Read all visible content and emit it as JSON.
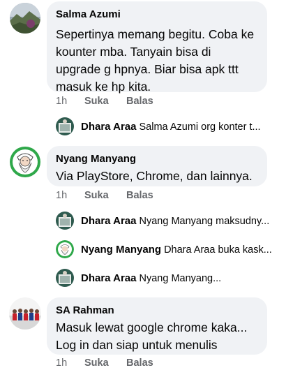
{
  "comments": [
    {
      "author": "Salma Azumi",
      "lines": [
        "Sepertinya memang begitu. Coba ke",
        "kounter mba. Tanyain bisa di",
        "upgrade g hpnya. Biar bisa apk ttt",
        "masuk ke hp kita."
      ],
      "time": "1h",
      "like_label": "Suka",
      "reply_label": "Balas",
      "avatar_icon": "landscape-avatar-icon"
    },
    {
      "author": "Nyang Manyang",
      "lines": [
        "Via PlayStore, Chrome, dan lainnya."
      ],
      "time": "1h",
      "like_label": "Suka",
      "reply_label": "Balas",
      "avatar_icon": "bearded-man-avatar-icon"
    },
    {
      "author": "SA Rahman",
      "lines": [
        "Masuk lewat google chrome kaka...",
        "Log in dan siap untuk menulis"
      ],
      "time": "1h",
      "like_label": "Suka",
      "reply_label": "Balas",
      "avatar_icon": "group-photo-avatar-icon"
    }
  ],
  "replies": [
    {
      "author": "Dhara Araa",
      "preview": "Salma Azumi org konter t..."
    },
    {
      "author": "Dhara Araa",
      "preview": "Nyang Manyang maksudny..."
    },
    {
      "author": "Nyang Manyang",
      "preview": "Dhara Araa buka kask..."
    },
    {
      "author": "Dhara Araa",
      "preview": "Nyang Manyang..."
    }
  ],
  "colors": {
    "bubble": "#f0f2f5",
    "meta_text": "#65676b",
    "primary_text": "#050505"
  }
}
